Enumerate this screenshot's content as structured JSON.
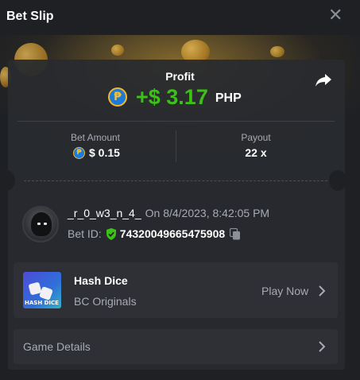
{
  "header": {
    "title": "Bet Slip",
    "close_icon": "close-icon"
  },
  "profit": {
    "label": "Profit",
    "value": "+$ 3.17",
    "currency": "PHP",
    "coin_symbol": "₱",
    "value_color": "#3bc117"
  },
  "stats": {
    "bet_amount_label": "Bet Amount",
    "bet_amount_value": "$ 0.15",
    "payout_label": "Payout",
    "payout_value": "22 x"
  },
  "user": {
    "username": "_r_0_w3_n_4_",
    "date": "On 8/4/2023, 8:42:05 PM",
    "bet_id_label": "Bet ID:",
    "bet_id": "74320049665475908"
  },
  "game": {
    "name": "Hash Dice",
    "provider": "BC Originals",
    "play_label": "Play Now",
    "thumb_tag": "HASH DICE"
  },
  "details": {
    "label": "Game Details"
  },
  "colors": {
    "background": "#1e2024",
    "card": "#27292e",
    "row": "#2e3035",
    "muted": "#a7abb3",
    "accent_green": "#3bc117"
  }
}
